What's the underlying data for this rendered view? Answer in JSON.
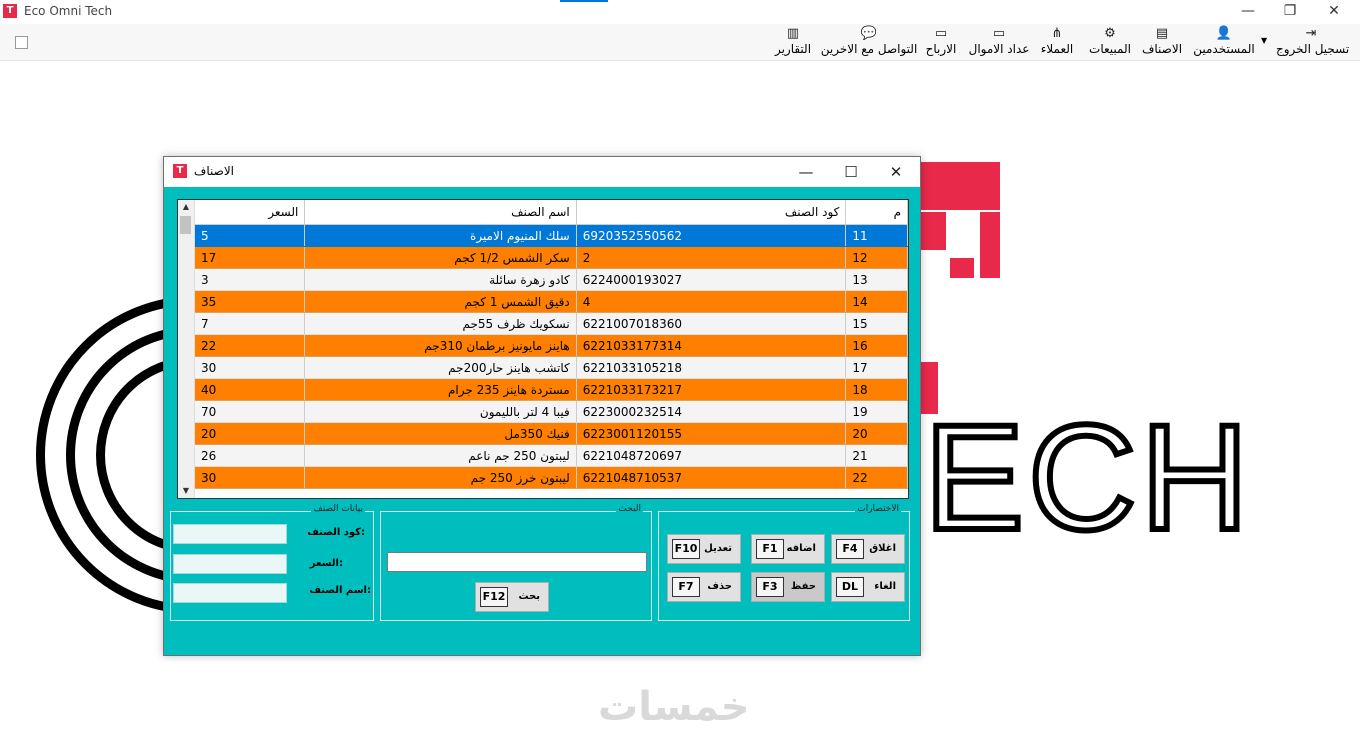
{
  "app": {
    "title": "Eco Omni Tech",
    "icon_text": "T"
  },
  "toolbar": {
    "items": [
      {
        "label": "تسجيل الخروج",
        "icon": "logout-icon",
        "glyph": "⇥"
      },
      {
        "label": "المستخدمين",
        "icon": "user-icon",
        "glyph": "👤"
      },
      {
        "label": "الاصناف",
        "icon": "boxes-icon",
        "glyph": "▤"
      },
      {
        "label": "المبيعات",
        "icon": "sales-icon",
        "glyph": "⚙"
      },
      {
        "label": "العملاء",
        "icon": "org-chart-icon",
        "glyph": "⋔"
      },
      {
        "label": "عداد الاموال",
        "icon": "money-counter-icon",
        "glyph": "▭"
      },
      {
        "label": "الارباح",
        "icon": "profit-icon",
        "glyph": "▭"
      },
      {
        "label": "التواصل مع الاخرين",
        "icon": "chat-icon",
        "glyph": "💬"
      },
      {
        "label": "التقارير",
        "icon": "report-icon",
        "glyph": "▥"
      }
    ]
  },
  "dialog": {
    "title": "الاصناف",
    "columns": [
      "م",
      "كود الصنف",
      "اسم الصنف",
      "السعر"
    ],
    "rows": [
      {
        "id": "11",
        "code": "6920352550562",
        "name": "سلك المنيوم الاميرة",
        "price": "5"
      },
      {
        "id": "12",
        "code": "2",
        "name": "سكر الشمس 1/2 كجم",
        "price": "17"
      },
      {
        "id": "13",
        "code": "6224000193027",
        "name": "كادو زهرة سائلة",
        "price": "3"
      },
      {
        "id": "14",
        "code": "4",
        "name": "دقيق الشمس 1 كجم",
        "price": "35"
      },
      {
        "id": "15",
        "code": "6221007018360",
        "name": "نسكويك ظرف 55جم",
        "price": "7"
      },
      {
        "id": "16",
        "code": "6221033177314",
        "name": "هاينز مايونيز برطمان 310جم",
        "price": "22"
      },
      {
        "id": "17",
        "code": "6221033105218",
        "name": "كاتشب هاينز حار200جم",
        "price": "30"
      },
      {
        "id": "18",
        "code": "6221033173217",
        "name": "مستردة هاينز 235 جرام",
        "price": "40"
      },
      {
        "id": "19",
        "code": "6223000232514",
        "name": "فيبا 4 لتر بالليمون",
        "price": "70"
      },
      {
        "id": "20",
        "code": "6223001120155",
        "name": "فنيك 350مل",
        "price": "20"
      },
      {
        "id": "21",
        "code": "6221048720697",
        "name": "ليبتون 250 جم ناعم",
        "price": "26"
      },
      {
        "id": "22",
        "code": "6221048710537",
        "name": "ليبتون خرز 250 جم",
        "price": "30"
      }
    ],
    "item_group": {
      "legend": "بيانات الصنف",
      "code_label": "كود الصنف:",
      "price_label": "السعر:",
      "name_label": "اسم الصنف:"
    },
    "search_group": {
      "legend": "البحث",
      "search_label": "بحث",
      "search_key": "F12"
    },
    "shortcuts_group": {
      "legend": "الاختصارات",
      "close_label": "اغلاق",
      "close_key": "F4",
      "add_label": "اضافه",
      "add_key": "F1",
      "edit_label": "تعديل",
      "edit_key": "F10",
      "cancel_label": "الغاء",
      "cancel_key": "DL",
      "save_label": "حفظ",
      "save_key": "F3",
      "delete_label": "حذف",
      "delete_key": "F7"
    }
  },
  "background": {
    "logo_text": "ECH",
    "watermark": "خمسات"
  },
  "colors": {
    "dialog_bg": "#00bebe",
    "row_highlight": "#ff7f00",
    "selection": "#0078d7",
    "logo_red": "#e8294a"
  }
}
